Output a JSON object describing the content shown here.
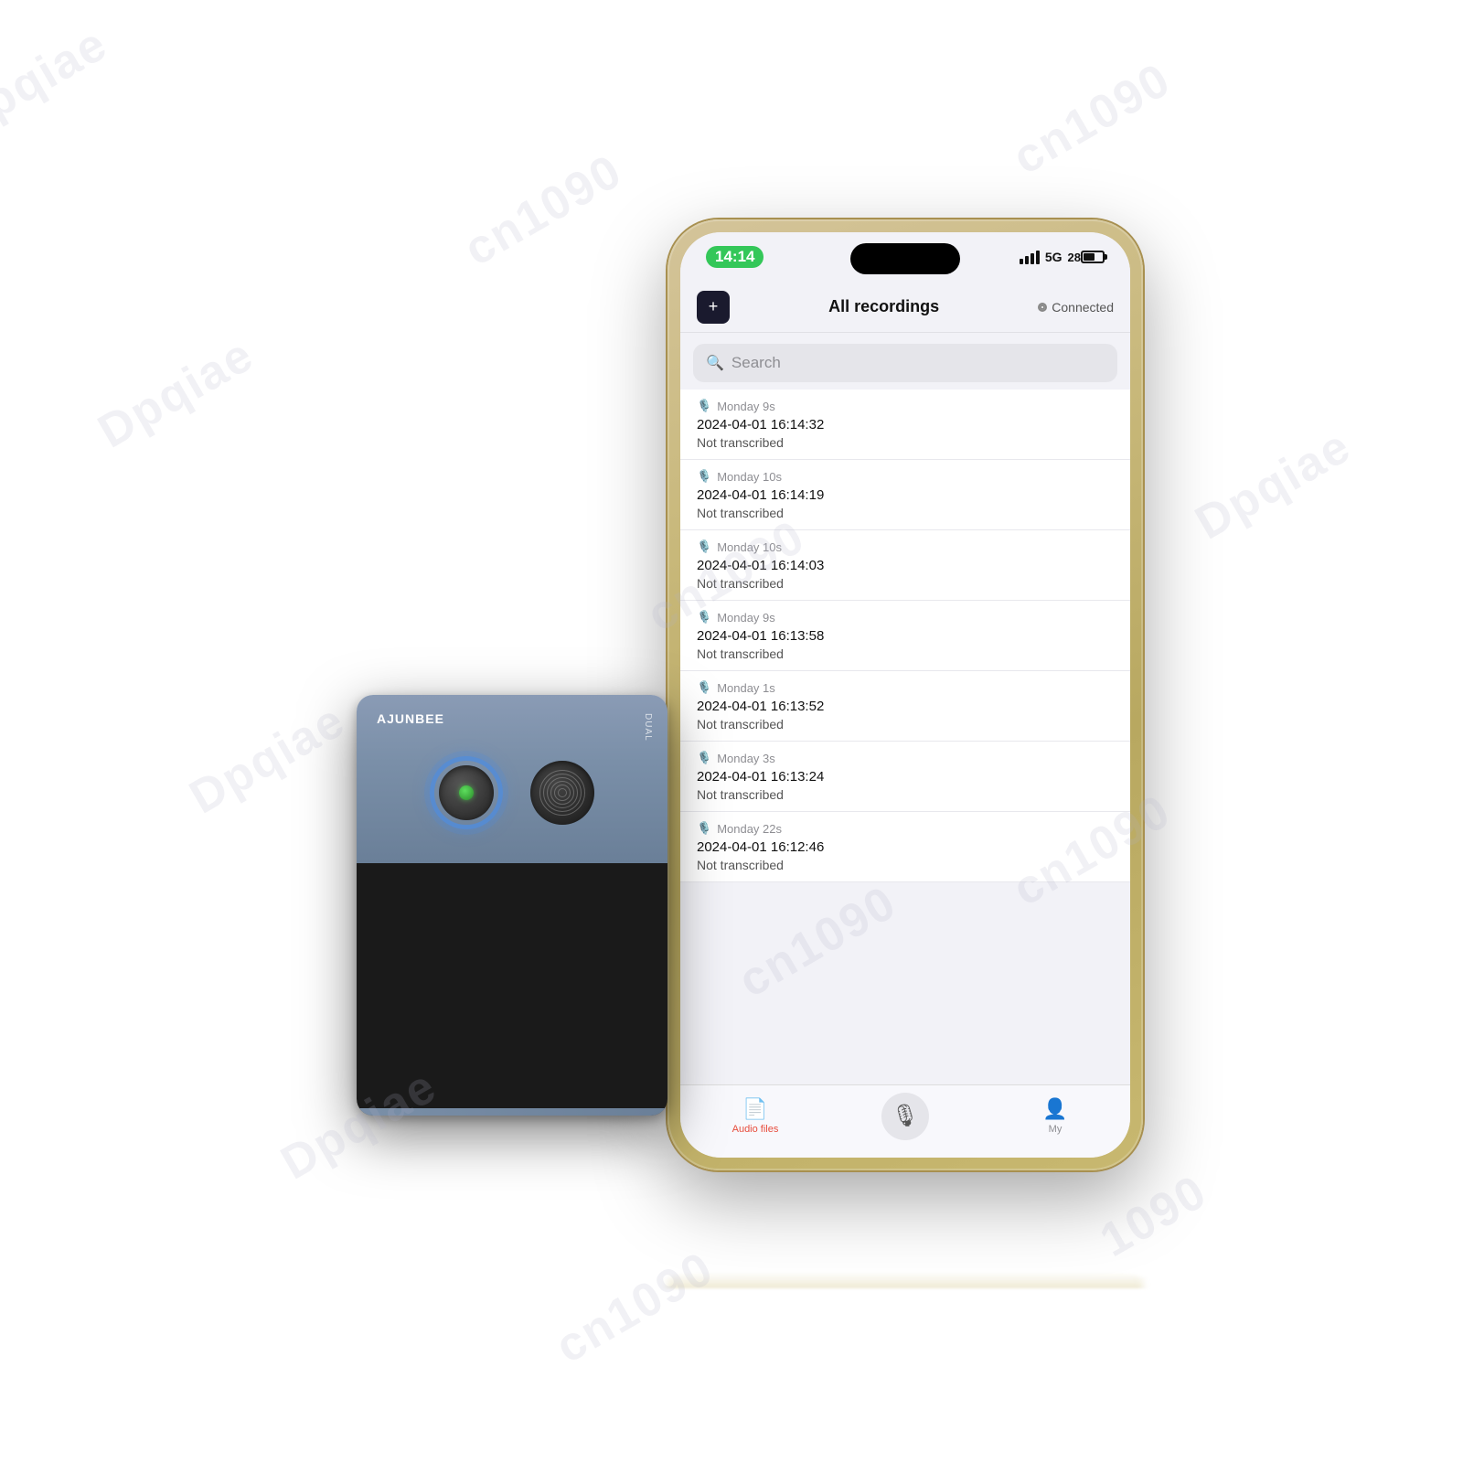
{
  "watermarks": [
    "Dpqiae",
    "cn1090",
    "Dpqiae",
    "cn1090",
    "Dpqiae",
    "cn1090",
    "Dpqiae",
    "cn1090",
    "Dpqiae",
    "cn1090",
    "cn1090",
    "1090"
  ],
  "phone": {
    "status_bar": {
      "time": "14:14",
      "signal_label": "5G",
      "battery_label": "28"
    },
    "header": {
      "title": "All recordings",
      "icon_label": "+",
      "connected_label": "Connected"
    },
    "search": {
      "placeholder": "Search"
    },
    "recordings": [
      {
        "day_time": "Monday 9s",
        "date": "2024-04-01 16:14:32",
        "status": "Not transcribed"
      },
      {
        "day_time": "Monday 10s",
        "date": "2024-04-01 16:14:19",
        "status": "Not transcribed"
      },
      {
        "day_time": "Monday 10s",
        "date": "2024-04-01 16:14:03",
        "status": "Not transcribed"
      },
      {
        "day_time": "Monday 9s",
        "date": "2024-04-01 16:13:58",
        "status": "Not transcribed"
      },
      {
        "day_time": "Monday 1s",
        "date": "2024-04-01 16:13:52",
        "status": "Not transcribed"
      },
      {
        "day_time": "Monday 3s",
        "date": "2024-04-01 16:13:24",
        "status": "Not transcribed"
      },
      {
        "day_time": "Monday 22s",
        "date": "2024-04-01 16:12:46",
        "status": "Not transcribed"
      }
    ],
    "tab_bar": {
      "audio_files_label": "Audio files",
      "my_label": "My"
    }
  },
  "device": {
    "brand": "AJUNBEE"
  }
}
